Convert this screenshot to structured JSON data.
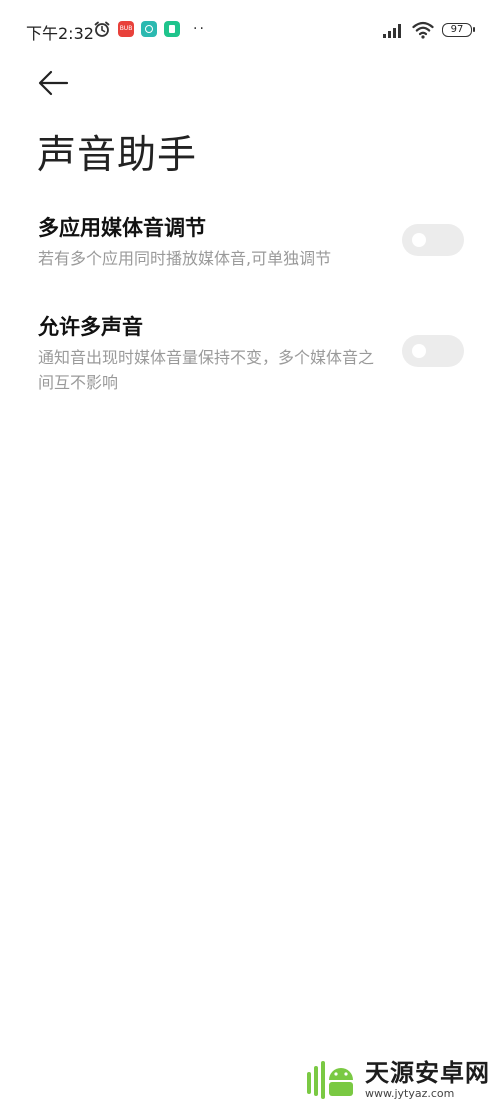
{
  "status_bar": {
    "time": "下午2:32",
    "app_red_label": "BUB",
    "more_dots": "··",
    "battery": "97"
  },
  "header": {
    "title": "声音助手"
  },
  "settings": [
    {
      "title": "多应用媒体音调节",
      "description": "若有多个应用同时播放媒体音,可单独调节",
      "enabled": false
    },
    {
      "title": "允许多声音",
      "description": "通知音出现时媒体音量保持不变，多个媒体音之间互不影响",
      "enabled": false
    }
  ],
  "watermark": {
    "title": "天源安卓网",
    "url": "www.jytyaz.com"
  },
  "colors": {
    "toggle_off": "#ececec",
    "description": "#9a9a9a",
    "watermark_green": "#7ac943"
  }
}
